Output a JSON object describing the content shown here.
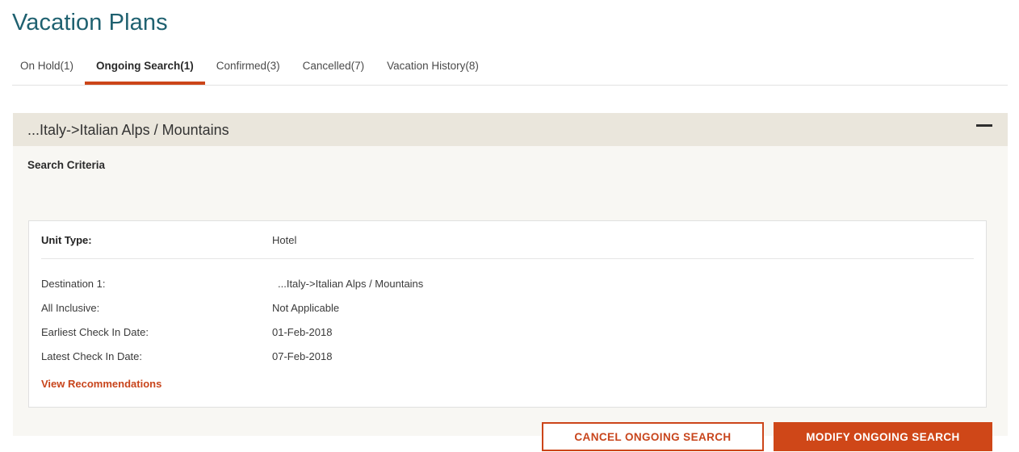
{
  "page": {
    "title": "Vacation Plans"
  },
  "tabs": [
    {
      "label": "On Hold(1)",
      "active": false
    },
    {
      "label": "Ongoing Search(1)",
      "active": true
    },
    {
      "label": "Confirmed(3)",
      "active": false
    },
    {
      "label": "Cancelled(7)",
      "active": false
    },
    {
      "label": "Vacation History(8)",
      "active": false
    }
  ],
  "panel": {
    "header_title": "...Italy->Italian Alps / Mountains",
    "collapse_icon": "minimize-icon",
    "section_title": "Search Criteria",
    "criteria": [
      {
        "label": "Unit Type:",
        "value": "Hotel"
      },
      {
        "label": "Destination 1:",
        "value": "...Italy->Italian Alps / Mountains"
      },
      {
        "label": "All Inclusive:",
        "value": "Not Applicable"
      },
      {
        "label": "Earliest Check In Date:",
        "value": "01-Feb-2018"
      },
      {
        "label": "Latest Check In Date:",
        "value": "07-Feb-2018"
      }
    ],
    "view_recommendations_label": "View Recommendations"
  },
  "actions": {
    "cancel_label": "CANCEL ONGOING SEARCH",
    "modify_label": "MODIFY ONGOING SEARCH"
  },
  "colors": {
    "title_teal": "#1f6170",
    "accent_orange": "#cc4519",
    "primary_button": "#cf4718",
    "link_orange": "#c8451c",
    "panel_header_beige": "#eae6dc",
    "panel_body": "#f8f7f3"
  }
}
